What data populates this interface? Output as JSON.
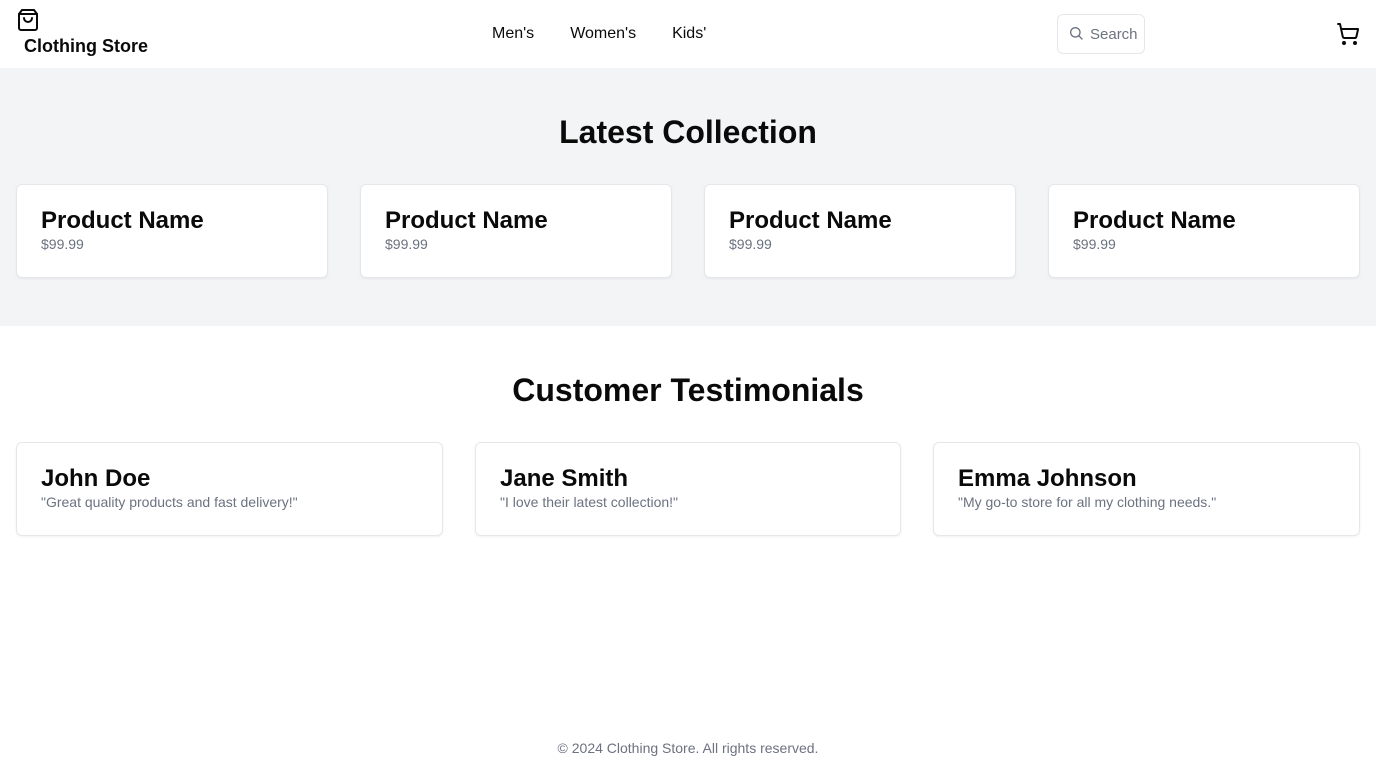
{
  "header": {
    "brand_name": "Clothing Store",
    "brand_icon": "shopping-bag-icon",
    "nav": [
      {
        "label": "Men's"
      },
      {
        "label": "Women's"
      },
      {
        "label": "Kids'"
      }
    ],
    "search": {
      "placeholder": "Search",
      "value": "",
      "icon": "search-icon"
    },
    "cart_icon": "cart-icon"
  },
  "collection": {
    "title": "Latest Collection",
    "products": [
      {
        "name": "Product Name",
        "price": "$99.99"
      },
      {
        "name": "Product Name",
        "price": "$99.99"
      },
      {
        "name": "Product Name",
        "price": "$99.99"
      },
      {
        "name": "Product Name",
        "price": "$99.99"
      }
    ]
  },
  "testimonials": {
    "title": "Customer Testimonials",
    "items": [
      {
        "name": "John Doe",
        "quote": "\"Great quality products and fast delivery!\""
      },
      {
        "name": "Jane Smith",
        "quote": "\"I love their latest collection!\""
      },
      {
        "name": "Emma Johnson",
        "quote": "\"My go-to store for all my clothing needs.\""
      }
    ]
  },
  "footer": {
    "text": "© 2024 Clothing Store. All rights reserved."
  },
  "colors": {
    "text": "#0a0a0a",
    "muted": "#6b7280",
    "section_bg": "#f3f4f6",
    "border": "#e5e7eb"
  }
}
